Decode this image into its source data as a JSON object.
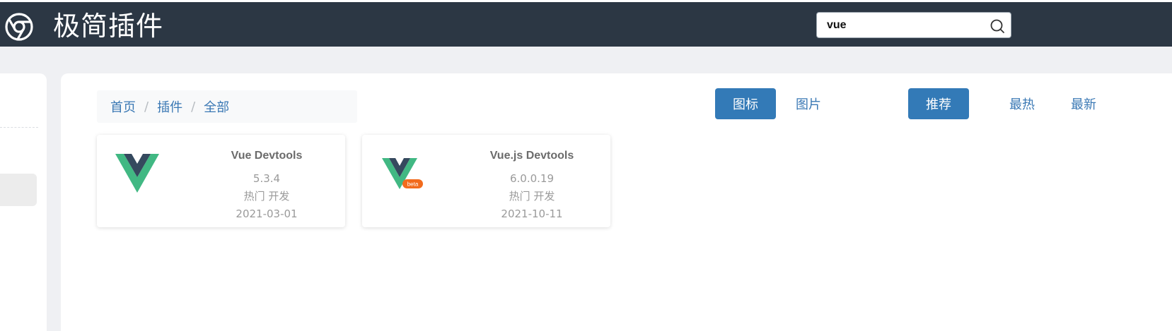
{
  "header": {
    "site_title": "极简插件",
    "logo_icon": "chrome-logo-icon",
    "search": {
      "value": "vue",
      "placeholder": "",
      "icon": "search-icon"
    }
  },
  "breadcrumb": {
    "items": [
      "首页",
      "插件",
      "全部"
    ],
    "separator": "/"
  },
  "view_toggle": {
    "icon_label": "图标",
    "image_label": "图片",
    "active": "图标"
  },
  "sort_tabs": {
    "recommend": "推荐",
    "hottest": "最热",
    "newest": "最新",
    "active": "推荐"
  },
  "plugins": [
    {
      "name": "Vue Devtools",
      "version": "5.3.4",
      "tags": "热门 开发",
      "date": "2021-03-01",
      "icon": "vue-logo-icon"
    },
    {
      "name": "Vue.js Devtools",
      "version": "6.0.0.19",
      "tags": "热门 开发",
      "date": "2021-10-11",
      "icon": "vue-beta-logo-icon",
      "badge": "beta"
    }
  ],
  "colors": {
    "topbar": "#2c3744",
    "primary": "#337ab7",
    "link": "#3a78b4",
    "vue_green": "#41b883",
    "vue_dark": "#35495e",
    "beta_orange": "#f26b1d"
  }
}
